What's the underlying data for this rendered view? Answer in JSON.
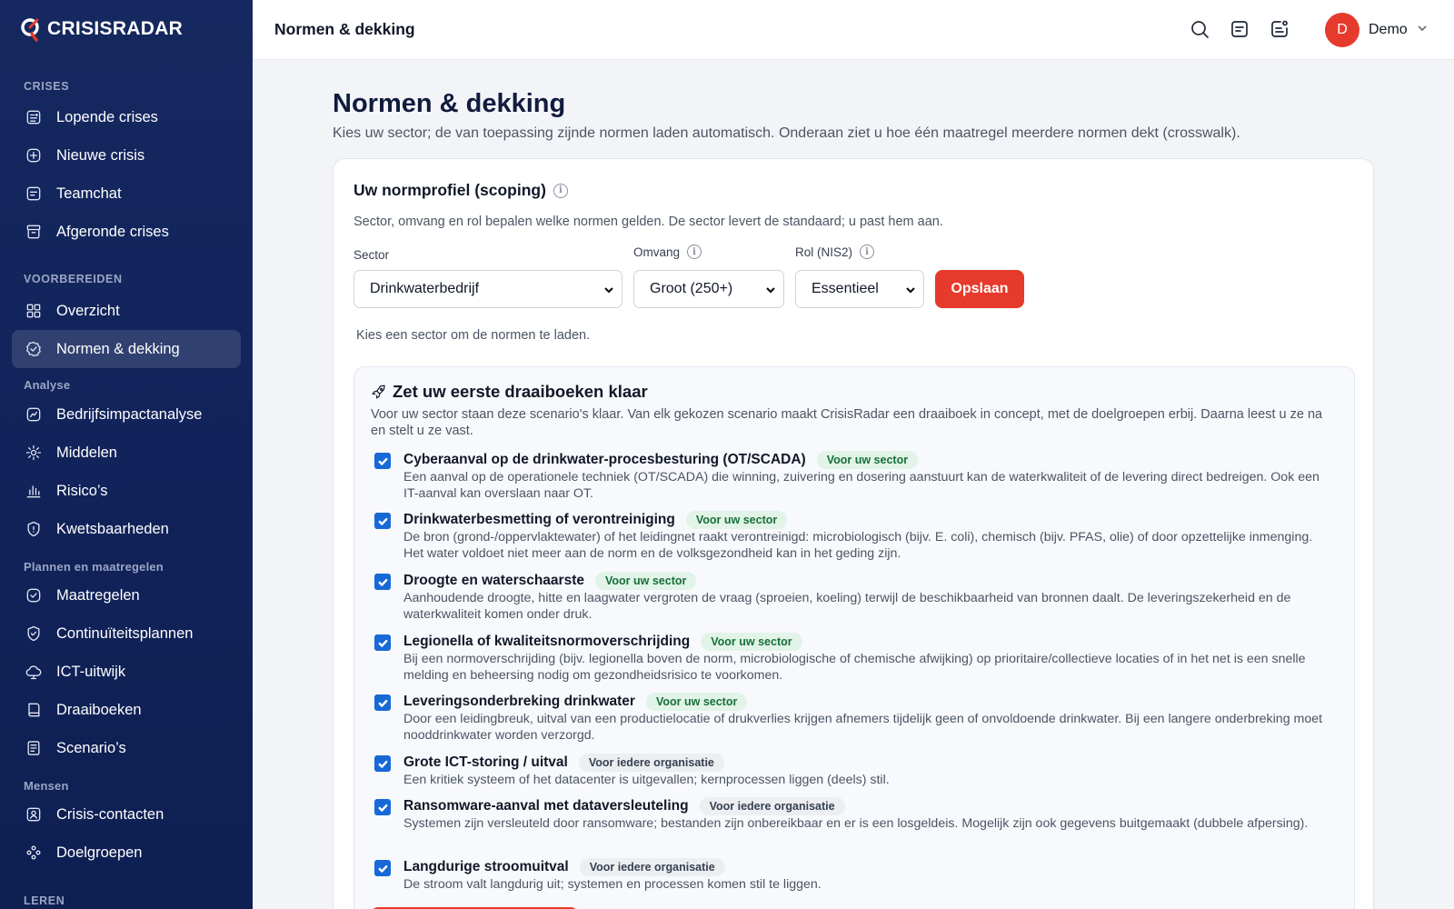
{
  "app": {
    "name": "CRISISRADAR",
    "brand_color": "#e53a2c",
    "sidebar_color": "#13265d"
  },
  "sidebar": {
    "sections": [
      {
        "label": "CRISES"
      },
      {
        "label": "VOORBEREIDEN"
      },
      {
        "label": "Analyse"
      },
      {
        "label": "Plannen en maatregelen"
      },
      {
        "label": "Mensen"
      },
      {
        "label": "LEREN"
      }
    ],
    "items": [
      {
        "label": "Lopende crises",
        "icon": "list-alert-icon"
      },
      {
        "label": "Nieuwe crisis",
        "icon": "plus-square-icon"
      },
      {
        "label": "Teamchat",
        "icon": "chat-icon"
      },
      {
        "label": "Afgeronde crises",
        "icon": "archive-icon"
      },
      {
        "label": "Overzicht",
        "icon": "grid-icon"
      },
      {
        "label": "Normen & dekking",
        "icon": "badge-check-icon",
        "active": true
      },
      {
        "label": "Bedrijfsimpactanalyse",
        "icon": "impact-icon"
      },
      {
        "label": "Middelen",
        "icon": "resources-icon"
      },
      {
        "label": "Risico’s",
        "icon": "bar-chart-icon"
      },
      {
        "label": "Kwetsbaarheden",
        "icon": "shield-alert-icon"
      },
      {
        "label": "Maatregelen",
        "icon": "check-badge-icon"
      },
      {
        "label": "Continuïteitsplannen",
        "icon": "shield-check-icon"
      },
      {
        "label": "ICT-uitwijk",
        "icon": "cloud-icon"
      },
      {
        "label": "Draaiboeken",
        "icon": "book-icon"
      },
      {
        "label": "Scenario’s",
        "icon": "document-icon"
      },
      {
        "label": "Crisis-contacten",
        "icon": "contact-icon"
      },
      {
        "label": "Doelgroepen",
        "icon": "group-icon"
      }
    ]
  },
  "topbar": {
    "title": "Normen & dekking",
    "user": {
      "initial": "D",
      "name": "Demo"
    },
    "icons": [
      "search-icon",
      "messages-icon",
      "notifications-icon"
    ]
  },
  "main": {
    "title": "Normen & dekking",
    "subtitle": "Kies uw sector; de van toepassing zijnde normen laden automatisch. Onderaan ziet u hoe één maatregel meerdere normen dekt (crosswalk).",
    "profile": {
      "title": "Uw normprofiel (scoping)",
      "description": "Sector, omvang en rol bepalen welke normen gelden. De sector levert de standaard; u past hem aan.",
      "sector_label": "Sector",
      "sector_value": "Drinkwaterbedrijf",
      "size_label": "Omvang",
      "size_value": "Groot (250+)",
      "role_label": "Rol (NIS2)",
      "role_value": "Essentieel",
      "save_label": "Opslaan",
      "hint": "Kies een sector om de normen te laden."
    },
    "playbooks": {
      "title": "Zet uw eerste draaiboeken klaar",
      "description": "Voor uw sector staan deze scenario's klaar. Van elk gekozen scenario maakt CrisisRadar een draaiboek in concept, met de doelgroepen erbij. Daarna leest u ze na en stelt u ze vast.",
      "scenarios": [
        {
          "title": "Cyberaanval op de drinkwater-procesbesturing (OT/SCADA)",
          "badge": "Voor uw sector",
          "badge_type": "sector",
          "checked": true,
          "description": "Een aanval op de operationele techniek (OT/SCADA) die winning, zuivering en dosering aanstuurt kan de waterkwaliteit of de levering direct bedreigen. Ook een IT-aanval kan overslaan naar OT."
        },
        {
          "title": "Drinkwaterbesmetting of verontreiniging",
          "badge": "Voor uw sector",
          "badge_type": "sector",
          "checked": true,
          "description": "De bron (grond-/oppervlaktewater) of het leidingnet raakt verontreinigd: microbiologisch (bijv. E. coli), chemisch (bijv. PFAS, olie) of door opzettelijke inmenging. Het water voldoet niet meer aan de norm en de volksgezondheid kan in het geding zijn."
        },
        {
          "title": "Droogte en waterschaarste",
          "badge": "Voor uw sector",
          "badge_type": "sector",
          "checked": true,
          "description": "Aanhoudende droogte, hitte en laagwater vergroten de vraag (sproeien, koeling) terwijl de beschikbaarheid van bronnen daalt. De leveringszekerheid en de waterkwaliteit komen onder druk."
        },
        {
          "title": "Legionella of kwaliteitsnormoverschrijding",
          "badge": "Voor uw sector",
          "badge_type": "sector",
          "checked": true,
          "description": "Bij een normoverschrijding (bijv. legionella boven de norm, microbiologische of chemische afwijking) op prioritaire/collectieve locaties of in het net is een snelle melding en beheersing nodig om gezondheidsrisico te voorkomen."
        },
        {
          "title": "Leveringsonderbreking drinkwater",
          "badge": "Voor uw sector",
          "badge_type": "sector",
          "checked": true,
          "description": "Door een leidingbreuk, uitval van een productielocatie of drukverlies krijgen afnemers tijdelijk geen of onvoldoende drinkwater. Bij een langere onderbreking moet nooddrinkwater worden verzorgd."
        },
        {
          "title": "Grote ICT-storing / uitval",
          "badge": "Voor iedere organisatie",
          "badge_type": "org",
          "checked": true,
          "description": "Een kritiek systeem of het datacenter is uitgevallen; kernprocessen liggen (deels) stil."
        },
        {
          "title": "Ransomware-aanval met dataversleuteling",
          "badge": "Voor iedere organisatie",
          "badge_type": "org",
          "checked": true,
          "description": "Systemen zijn versleuteld door ransomware; bestanden zijn onbereikbaar en er is een losgeldeis. Mogelijk zijn ook gegevens buitgemaakt (dubbele afpersing)."
        },
        {
          "title": "Langdurige stroomuitval",
          "badge": "Voor iedere organisatie",
          "badge_type": "org",
          "checked": true,
          "description": "De stroom valt langdurig uit; systemen en processen komen stil te liggen."
        }
      ]
    }
  }
}
